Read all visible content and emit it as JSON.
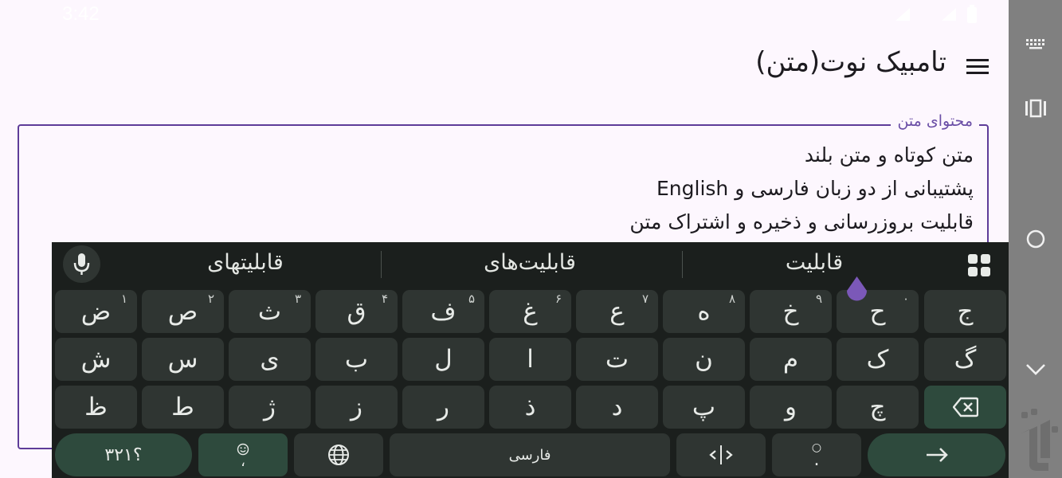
{
  "status_bar": {
    "time": "3:42"
  },
  "app_bar": {
    "title": "تامبیک نوت(متن)"
  },
  "text_field": {
    "label": "محتوای متن",
    "lines": [
      "متن کوتاه و متن بلند",
      "پشتیبانی از دو زبان فارسی و English",
      "قابلیت بروزرسانی و ذخیره و اشتراک متن"
    ]
  },
  "keyboard": {
    "suggestions": [
      "قابلیتهای",
      "قابلیت‌های",
      "قابلیت"
    ],
    "rows": [
      [
        {
          "k": "ض",
          "h": "۱"
        },
        {
          "k": "ص",
          "h": "۲"
        },
        {
          "k": "ث",
          "h": "۳"
        },
        {
          "k": "ق",
          "h": "۴"
        },
        {
          "k": "ف",
          "h": "۵"
        },
        {
          "k": "غ",
          "h": "۶"
        },
        {
          "k": "ع",
          "h": "۷"
        },
        {
          "k": "ه",
          "h": "۸"
        },
        {
          "k": "خ",
          "h": "۹"
        },
        {
          "k": "ح",
          "h": "۰"
        },
        {
          "k": "ج",
          "h": ""
        }
      ],
      [
        {
          "k": "ش"
        },
        {
          "k": "س"
        },
        {
          "k": "ی"
        },
        {
          "k": "ب"
        },
        {
          "k": "ل"
        },
        {
          "k": "ا"
        },
        {
          "k": "ت"
        },
        {
          "k": "ن"
        },
        {
          "k": "م"
        },
        {
          "k": "ک"
        },
        {
          "k": "گ"
        }
      ],
      [
        {
          "k": "ظ"
        },
        {
          "k": "ط"
        },
        {
          "k": "ژ"
        },
        {
          "k": "ز"
        },
        {
          "k": "ر"
        },
        {
          "k": "ذ"
        },
        {
          "k": "د"
        },
        {
          "k": "پ"
        },
        {
          "k": "و"
        },
        {
          "k": "چ"
        }
      ]
    ],
    "number_key": "؟۳۲۱",
    "emoji_key_sub": "،",
    "space_label": "فارسی",
    "punct_key_sub": ".",
    "icons": {
      "mic": "mic-icon",
      "grid": "apps-grid-icon",
      "backspace": "backspace-icon",
      "globe": "globe-icon",
      "cursor": "cursor-move-icon",
      "enter": "enter-icon",
      "emoji": "emoji-icon"
    }
  },
  "nav_bar": {
    "icons": [
      "keyboard-icon",
      "recents-icon",
      "home-icon",
      "back-icon"
    ]
  },
  "colors": {
    "accent": "#5e3c99",
    "background": "#fdf7fe",
    "keyboard_bg": "#1b1f1d",
    "key_bg": "#2f3532",
    "key_action_bg": "#2e4a3d"
  }
}
